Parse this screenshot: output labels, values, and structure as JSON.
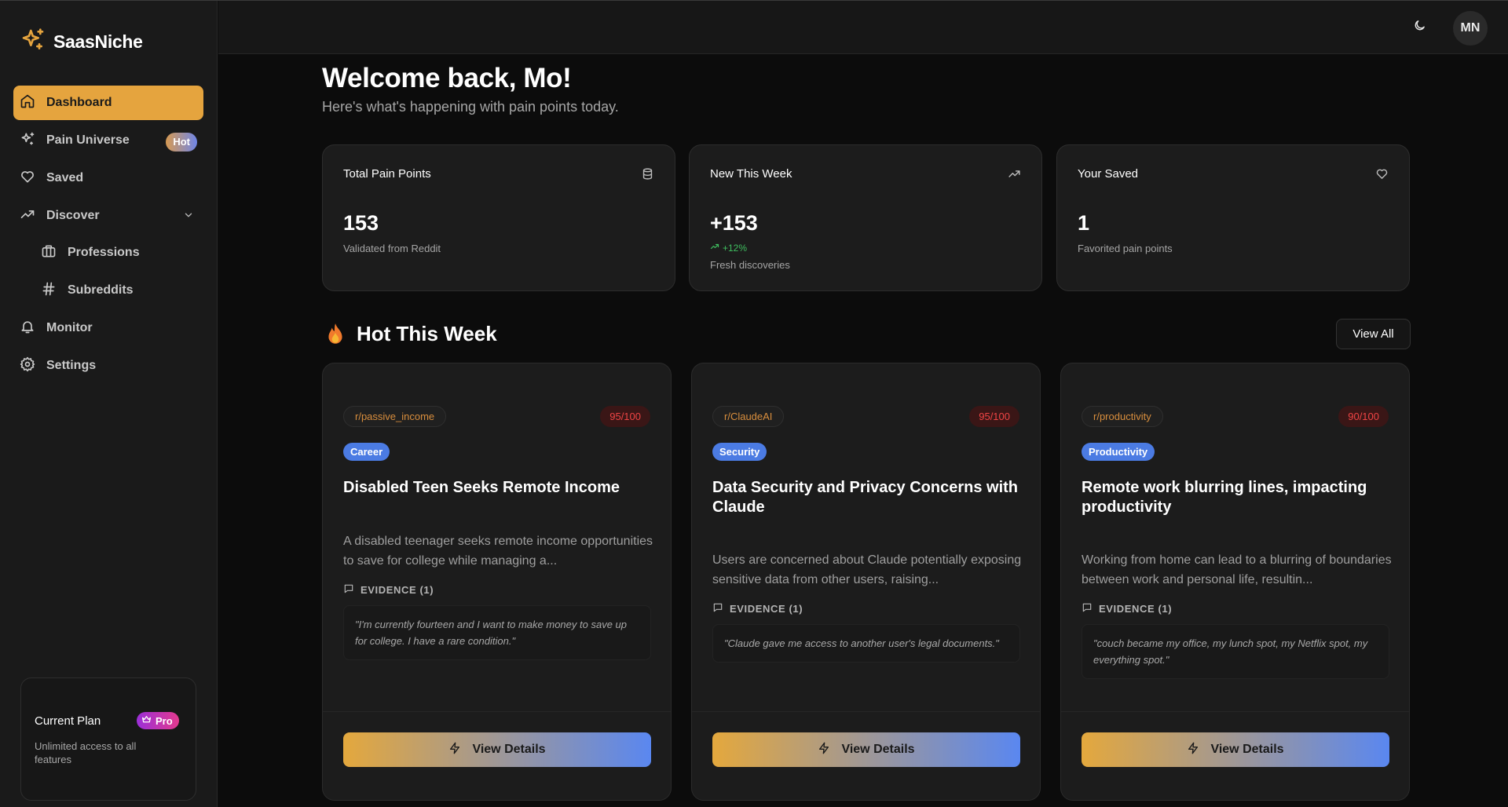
{
  "brand": {
    "name": "SaasNiche"
  },
  "sidebar": {
    "items": [
      {
        "label": "Dashboard",
        "icon": "home-icon",
        "active": true
      },
      {
        "label": "Pain Universe",
        "icon": "sparkles-icon",
        "badge": "Hot"
      },
      {
        "label": "Saved",
        "icon": "heart-icon"
      },
      {
        "label": "Discover",
        "icon": "trending-up-icon"
      },
      {
        "label": "Professions",
        "icon": "briefcase-icon"
      },
      {
        "label": "Subreddits",
        "icon": "hash-icon"
      },
      {
        "label": "Monitor",
        "icon": "bell-icon"
      },
      {
        "label": "Settings",
        "icon": "gear-icon"
      }
    ],
    "plan": {
      "title": "Current Plan",
      "badge": "Pro",
      "description": "Unlimited access to all features"
    }
  },
  "header": {
    "avatar_initials": "MN",
    "theme_icon": "moon-icon"
  },
  "main": {
    "welcome": "Welcome back, Mo!",
    "subtitle": "Here's what's happening with pain points today.",
    "stats": [
      {
        "title": "Total Pain Points",
        "value": "153",
        "sub": "Validated from Reddit",
        "icon": "database-icon"
      },
      {
        "title": "New This Week",
        "value": "+153",
        "trend": "+12%",
        "sub": "Fresh discoveries",
        "icon": "trending-up-icon"
      },
      {
        "title": "Your Saved",
        "value": "1",
        "sub": "Favorited pain points",
        "icon": "heart-icon"
      }
    ],
    "section_title": "Hot This Week",
    "view_all": "View All",
    "cards": [
      {
        "subreddit": "r/passive_income",
        "score": "95/100",
        "category": "Career",
        "title": "Disabled Teen Seeks Remote Income",
        "description": "A disabled teenager seeks remote income opportunities to save for college while managing a...",
        "evidence_label": "EVIDENCE (1)",
        "quote": "\"I'm currently fourteen and I want to make money to save up for college. I have a rare condition.\"",
        "button": "View Details"
      },
      {
        "subreddit": "r/ClaudeAI",
        "score": "95/100",
        "category": "Security",
        "title": "Data Security and Privacy Concerns with Claude",
        "description": "Users are concerned about Claude potentially exposing sensitive data from other users, raising...",
        "evidence_label": "EVIDENCE (1)",
        "quote": "\"Claude gave me access to another user's legal documents.\"",
        "button": "View Details"
      },
      {
        "subreddit": "r/productivity",
        "score": "90/100",
        "category": "Productivity",
        "title": "Remote work blurring lines, impacting productivity",
        "description": "Working from home can lead to a blurring of boundaries between work and personal life, resultin...",
        "evidence_label": "EVIDENCE (1)",
        "quote": "\"couch became my office, my lunch spot, my Netflix spot, my everything spot.\"",
        "button": "View Details"
      }
    ]
  },
  "colors": {
    "accent": "#e5a43e",
    "blue": "#5a87f0",
    "score_red": "#ef4444",
    "trend_green": "#3fbf5f"
  }
}
